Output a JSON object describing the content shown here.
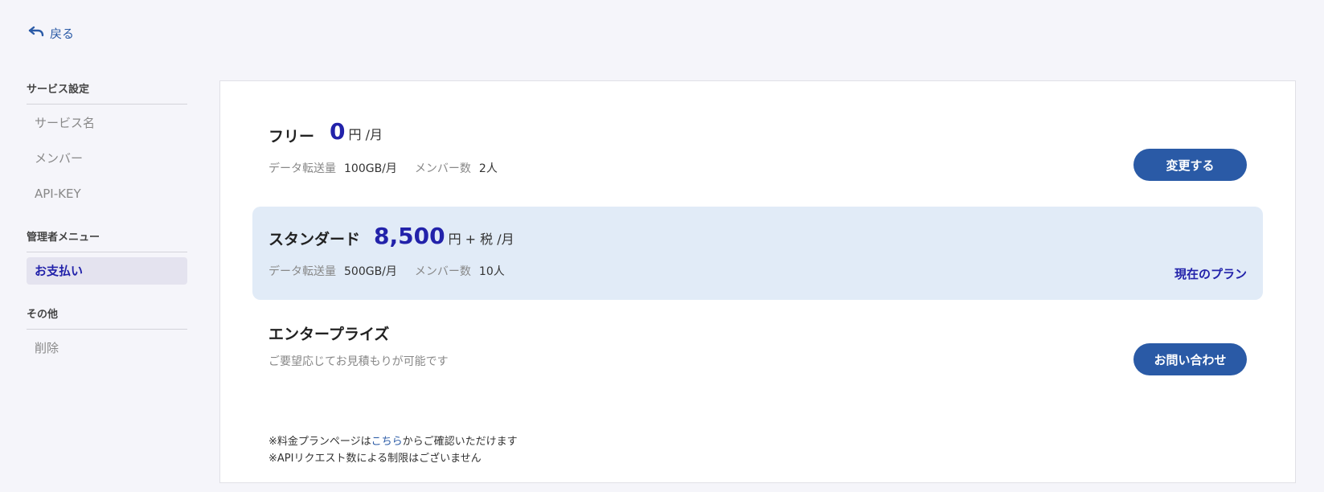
{
  "back": {
    "label": "戻る",
    "icon": "undo-arrow-icon"
  },
  "sidebar": {
    "sections": [
      {
        "heading": "サービス設定",
        "items": [
          "サービス名",
          "メンバー",
          "API-KEY"
        ]
      },
      {
        "heading": "管理者メニュー",
        "items": [
          "お支払い"
        ]
      },
      {
        "heading": "その他",
        "items": [
          "削除"
        ]
      }
    ]
  },
  "plans": {
    "free": {
      "name": "フリー",
      "price": "0",
      "unit": "円 /月",
      "transfer_label": "データ転送量",
      "transfer_value": "100GB/月",
      "members_label": "メンバー数",
      "members_value": "2人",
      "action": "変更する"
    },
    "standard": {
      "name": "スタンダード",
      "price": "8,500",
      "unit": "円 + 税 /月",
      "transfer_label": "データ転送量",
      "transfer_value": "500GB/月",
      "members_label": "メンバー数",
      "members_value": "10人",
      "status": "現在のプラン"
    },
    "enterprise": {
      "name": "エンタープライズ",
      "description": "ご要望応じてお見積もりが可能です",
      "action": "お問い合わせ"
    }
  },
  "notes": {
    "line1_prefix": "※料金プランページは",
    "line1_link": "こちら",
    "line1_suffix": "からご確認いただけます",
    "line2": "※APIリクエスト数による制限はございません"
  },
  "colors": {
    "accent": "#2a5aa6",
    "price": "#2222aa",
    "current_bg": "#e1ebf7",
    "page_bg": "#f5f5fa"
  }
}
